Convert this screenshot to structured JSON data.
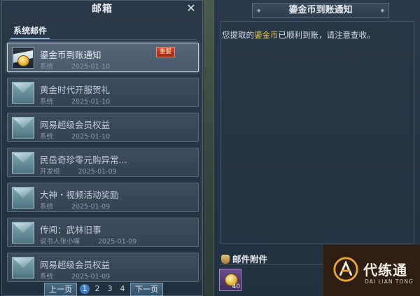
{
  "left_panel": {
    "title": "邮箱",
    "close_glyph": "✕",
    "tab": "系统邮件",
    "mails": [
      {
        "title": "鎏金币到账通知",
        "sender": "系统",
        "date": "2025-01-10",
        "badge": "重要",
        "selected": true,
        "opened": true
      },
      {
        "title": "黄金时代开服贺礼",
        "sender": "系统",
        "date": "2025-01-10",
        "selected": false
      },
      {
        "title": "网易超级会员权益",
        "sender": "系统",
        "date": "2025-01-10",
        "selected": false
      },
      {
        "title": "民岳奇珍零元购异常...",
        "sender": "开发组",
        "date": "2025-01-09",
        "selected": false
      },
      {
        "title": "大神・视频活动奖励",
        "sender": "系统",
        "date": "2025-01-09",
        "selected": false
      },
      {
        "title": "传闻：武林旧事",
        "sender": "说书人张小嘴",
        "date": "2025-01-09",
        "selected": false
      },
      {
        "title": "网易超级会员权益",
        "sender": "系统",
        "date": "2025-01-09",
        "selected": false
      }
    ],
    "pager": {
      "prev": "上一页",
      "pages": [
        "1",
        "2",
        "3",
        "4"
      ],
      "current": "1",
      "next": "下一页"
    }
  },
  "right_panel": {
    "title": "鎏金币到账通知",
    "body_before": "您提取的",
    "body_highlight": "鎏金币",
    "body_after": "已顺利到账，请注意查收。",
    "attachments_title": "邮件附件",
    "attachment": {
      "icon": "gold-coin-icon",
      "quantity": "40"
    }
  },
  "watermark": {
    "name": "代练通",
    "pinyin": "DAI LIAN TONG"
  },
  "colors": {
    "highlight": "#e9c25a",
    "badge": "#c23a22",
    "page_active": "#3e7dc5"
  }
}
